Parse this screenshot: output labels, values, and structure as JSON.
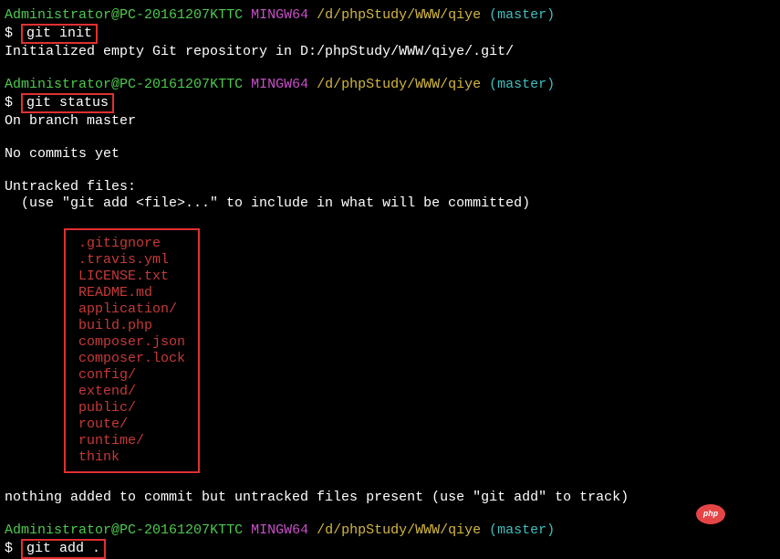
{
  "prompt": {
    "user": "Administrator",
    "at": "@",
    "host": "PC-20161207KTTC",
    "mingw": " MINGW64 ",
    "path": "/d/phpStudy/WWW/qiye",
    "branch": " (master)",
    "dollar": "$ "
  },
  "cmd1": "git init",
  "out1": "Initialized empty Git repository in D:/phpStudy/WWW/qiye/.git/",
  "cmd2": "git status",
  "out2_line1": "On branch master",
  "out2_line2": "No commits yet",
  "out2_line3": "Untracked files:",
  "out2_line4": "  (use \"git add <file>...\" to include in what will be committed)",
  "untracked_files": [
    ".gitignore",
    ".travis.yml",
    "LICENSE.txt",
    "README.md",
    "application/",
    "build.php",
    "composer.json",
    "composer.lock",
    "config/",
    "extend/",
    "public/",
    "route/",
    "runtime/",
    "think"
  ],
  "out2_footer": "nothing added to commit but untracked files present (use \"git add\" to track)",
  "cmd3": "git add .",
  "php_badge": "php"
}
